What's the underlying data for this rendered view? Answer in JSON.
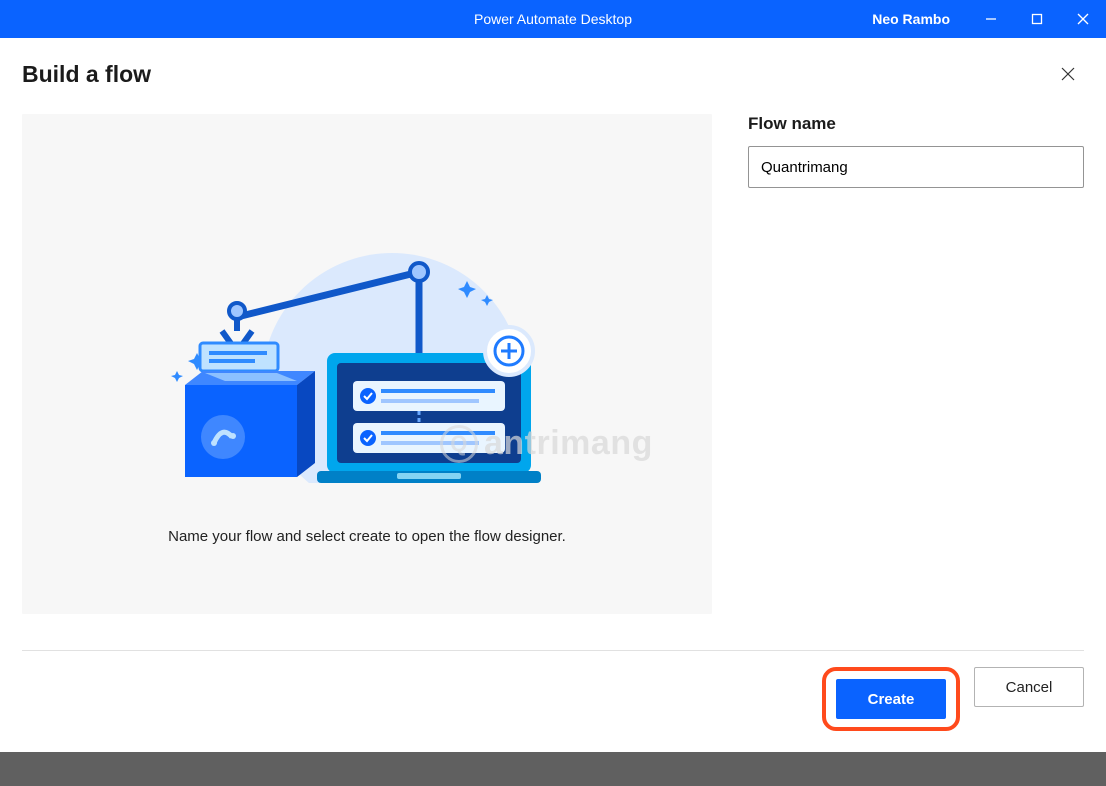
{
  "titlebar": {
    "app_title": "Power Automate Desktop",
    "user_name": "Neo Rambo"
  },
  "dialog": {
    "title": "Build a flow",
    "panel_caption": "Name your flow and select create to open the flow designer.",
    "flow_name_label": "Flow name",
    "flow_name_value": "Quantrimang"
  },
  "footer": {
    "create_label": "Create",
    "cancel_label": "Cancel"
  },
  "watermark": {
    "text": "antrimang"
  }
}
